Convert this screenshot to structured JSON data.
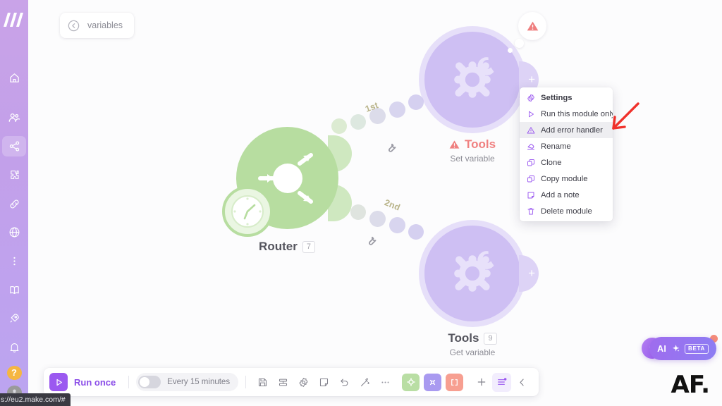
{
  "app": {
    "brand": "make-logo",
    "status_url": "s://eu2.make.com/#"
  },
  "sidebar": {
    "items": [
      {
        "name": "home-icon",
        "label": "Home",
        "active": false
      },
      {
        "name": "team-icon",
        "label": "Team",
        "active": false
      },
      {
        "name": "scenarios-icon",
        "label": "Scenarios",
        "active": true
      },
      {
        "name": "templates-icon",
        "label": "Templates",
        "active": false
      },
      {
        "name": "connections-icon",
        "label": "Connections",
        "active": false
      },
      {
        "name": "webhooks-icon",
        "label": "Webhooks",
        "active": false
      },
      {
        "name": "more-icon",
        "label": "More",
        "active": false
      }
    ],
    "lower_items": [
      {
        "name": "book-icon",
        "label": "Docs"
      },
      {
        "name": "rocket-icon",
        "label": "What's new"
      },
      {
        "name": "bell-icon",
        "label": "Notifications"
      }
    ],
    "help_label": "?",
    "avatar_label": ""
  },
  "breadcrumb": {
    "back_icon": "back-arrow-icon",
    "label": "variables"
  },
  "flow": {
    "router": {
      "title": "Router",
      "badge": "7",
      "icon": "router-icon",
      "clock_icon": "clock-icon"
    },
    "tools_top": {
      "title": "Tools",
      "subtitle": "Set variable",
      "warning": true,
      "warning_icon": "warning-triangle-icon",
      "icon": "tools-icon"
    },
    "tools_bottom": {
      "title": "Tools",
      "badge": "9",
      "subtitle": "Get variable",
      "icon": "tools-icon"
    },
    "connectors": [
      {
        "label": "1st",
        "wrench_icon": "wrench-icon"
      },
      {
        "label": "2nd",
        "wrench_icon": "wrench-icon"
      }
    ]
  },
  "context_menu": {
    "items": [
      {
        "label": "Settings",
        "icon": "gear-icon",
        "bold": true,
        "highlight": false
      },
      {
        "label": "Run this module only",
        "icon": "play-icon",
        "bold": false,
        "highlight": false
      },
      {
        "label": "Add error handler",
        "icon": "warning-triangle-icon",
        "bold": false,
        "highlight": true
      },
      {
        "label": "Rename",
        "icon": "tag-icon",
        "bold": false,
        "highlight": false
      },
      {
        "label": "Clone",
        "icon": "clone-icon",
        "bold": false,
        "highlight": false
      },
      {
        "label": "Copy module",
        "icon": "copy-icon",
        "bold": false,
        "highlight": false
      },
      {
        "label": "Add a note",
        "icon": "note-icon",
        "bold": false,
        "highlight": false
      },
      {
        "label": "Delete module",
        "icon": "trash-icon",
        "bold": false,
        "highlight": false
      }
    ]
  },
  "annotation": {
    "arrow_color": "#f0312b",
    "points_to": "Add error handler"
  },
  "toolbar": {
    "run_once_label": "Run once",
    "run_once_icon": "play-icon",
    "schedule_label": "Every 15 minutes",
    "schedule_enabled": false,
    "icons": [
      {
        "name": "save-icon",
        "label": "Save"
      },
      {
        "name": "align-icon",
        "label": "Auto-align"
      },
      {
        "name": "settings-icon",
        "label": "Scenario settings"
      },
      {
        "name": "notes-icon",
        "label": "Notes"
      },
      {
        "name": "undo-icon",
        "label": "Undo"
      },
      {
        "name": "magic-icon",
        "label": "Explain flow"
      },
      {
        "name": "more-icon",
        "label": "More"
      }
    ],
    "chips": [
      {
        "name": "router-chip",
        "color": "#b7dda0",
        "icon": "router-icon"
      },
      {
        "name": "tools-chip",
        "color": "#a99af0",
        "icon": "tools-icon"
      },
      {
        "name": "flow-chip",
        "color": "#f79f91",
        "icon": "flow-icon"
      }
    ],
    "right_icons": [
      {
        "name": "add-module-icon",
        "label": "Add another module",
        "selected": false
      },
      {
        "name": "controls-icon",
        "label": "Controls",
        "selected": true
      },
      {
        "name": "collapse-icon",
        "label": "Collapse",
        "selected": false
      }
    ]
  },
  "widgets": {
    "hint_icon": "lightbulb-icon",
    "ai_label": "AI",
    "ai_sparkle_icon": "sparkle-icon",
    "ai_beta_label": "BETA",
    "watermark": "AF."
  },
  "colors": {
    "brand_purple": "#8b4ee8",
    "router_green": "#b7dda0",
    "tools_purple": "#d2c4f3",
    "warning_red": "#ef7f7f",
    "accent_coral": "#f79f91"
  }
}
